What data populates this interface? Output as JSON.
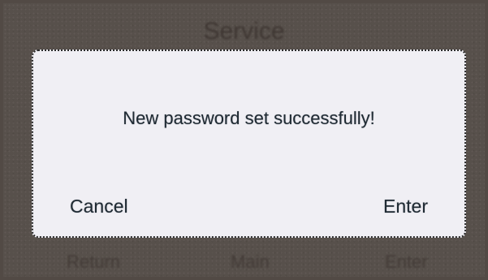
{
  "background": {
    "title": "Service",
    "buttons": {
      "return_label": "Return",
      "main_label": "Main",
      "enter_label": "Enter"
    }
  },
  "dialog": {
    "message": "New password set successfully!",
    "cancel_label": "Cancel",
    "enter_label": "Enter"
  },
  "colors": {
    "screen_background": "#524a45",
    "dialog_background": "#f0eff4",
    "text": "#1f2a33"
  }
}
